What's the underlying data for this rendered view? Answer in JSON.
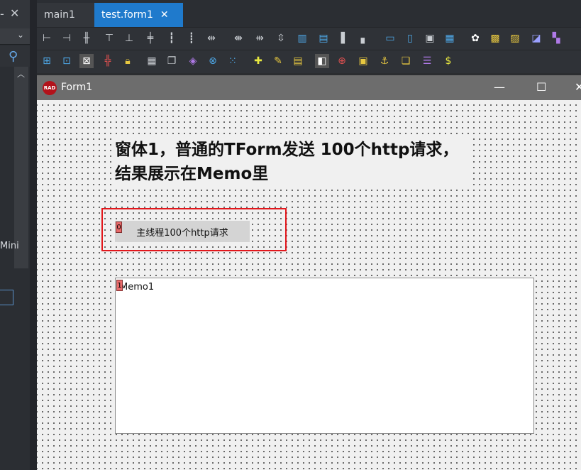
{
  "left_panel": {
    "partial_label": "Mini"
  },
  "tabs": [
    {
      "label": "main1",
      "active": false
    },
    {
      "label": "test.form1",
      "active": true
    }
  ],
  "toolbar_row1": [
    "align-left-icon",
    "align-right-icon",
    "align-center-h-icon",
    "align-top-icon",
    "align-bottom-icon",
    "align-middle-icon",
    "space-equal-h-icon",
    "space-increase-h-icon",
    "space-decrease-h-icon",
    "space-remove-h-icon",
    "space-equal-v-icon",
    "space-increase-v-icon",
    "space-decrease-v-icon",
    "space-remove-v-icon",
    "center-h-window-icon",
    "center-v-window-icon",
    "make-same-width-icon",
    "make-same-height-icon",
    "make-same-size-icon",
    "size-to-grid-icon",
    "align-to-grid-icon",
    "bring-to-front-icon",
    "send-to-back-icon",
    "snap-icon"
  ],
  "toolbar_row2": [
    "select-all-icon",
    "select-child-icon",
    "select-parent-icon",
    "tab-order-icon",
    "lock-controls-icon",
    "grid-icon",
    "copy-icon",
    "paste-icon",
    "delete-icon",
    "dots-icon",
    "component-icon",
    "wand-icon",
    "component-list-icon",
    "form-view-icon",
    "help-icon",
    "image-icon",
    "anchor-icon",
    "layers-icon",
    "stack-icon",
    "money-icon"
  ],
  "form": {
    "title": "Form1",
    "logo_text": "RAD",
    "heading_line1": "窗体1，普通的TForm发送 100个http请求，",
    "heading_line2": "结果展示在Memo里",
    "button_label": "主线程100个http请求",
    "button_taborder": "0",
    "memo_text": "Memo1",
    "memo_taborder": "1"
  },
  "colors": {
    "accent": "#1f7acc",
    "selection_frame": "#e2171c",
    "taborder_badge": "#e86a6a",
    "form_titlebar": "#6d6d6d"
  }
}
